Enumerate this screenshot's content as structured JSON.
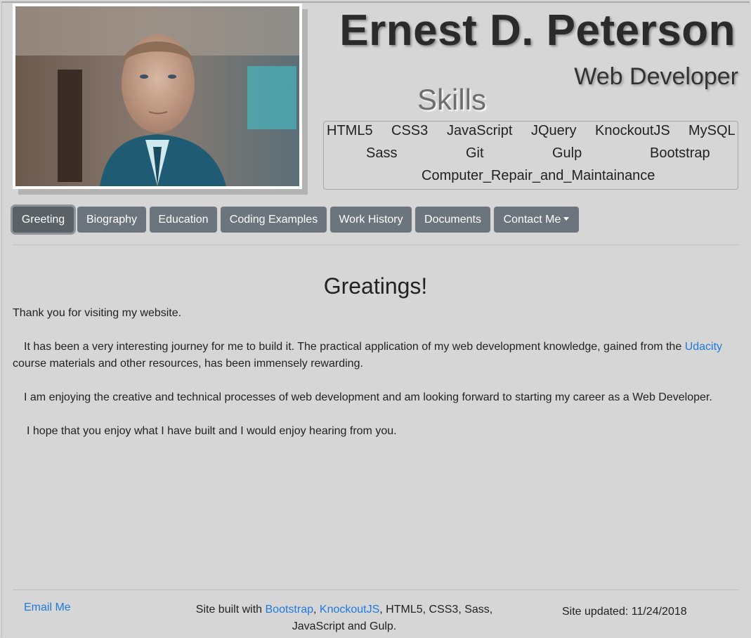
{
  "header": {
    "name": "Ernest D. Peterson",
    "role": "Web Developer",
    "skills_title": "Skills",
    "skills": [
      "HTML5",
      "CSS3",
      "JavaScript",
      "JQuery",
      "KnockoutJS",
      "MySQL",
      "Sass",
      "Git",
      "Gulp",
      "Bootstrap",
      "Computer_Repair_and_Maintainance"
    ]
  },
  "nav": {
    "items": [
      "Greeting",
      "Biography",
      "Education",
      "Coding Examples",
      "Work History",
      "Documents",
      "Contact Me"
    ],
    "active": "Greeting"
  },
  "content": {
    "heading": "Greatings!",
    "p1": "Thank you for visiting my website.",
    "p2_before": "It has been a very interesting journey for me to build it. The practical application of my web development knowledge, gained from the",
    "p2_link": "Udacity",
    "p2_after": "course materials and other resources, has been immensely rewarding.",
    "p3": "I am enjoying the creative and technical processes of web development and am looking forward to starting my career as a Web Developer.",
    "p4": "I hope that you enjoy what I have built and I would enjoy hearing from you."
  },
  "footer": {
    "email_label": "Email Me",
    "built_prefix": "Site built with",
    "built_link1": "Bootstrap",
    "built_sep": ",",
    "built_link2": "KnockoutJS",
    "built_suffix": ", HTML5, CSS3, Sass, JavaScript and Gulp.",
    "updated": "Site updated: 11/24/2018"
  },
  "colors": {
    "background": "#d6d6d6",
    "button": "#6c757d",
    "link": "#1e7ae0"
  }
}
